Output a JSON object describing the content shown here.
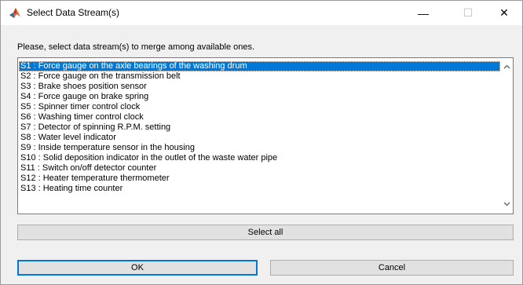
{
  "window": {
    "title": "Select Data Stream(s)",
    "controls": {
      "minimize": "—",
      "maximize": "☐",
      "close": "✕"
    }
  },
  "prompt": "Please, select data stream(s) to merge among available ones.",
  "streams": [
    {
      "label": "S1 : Force gauge on the axle bearings of the washing drum",
      "selected": true
    },
    {
      "label": "S2 : Force gauge on the transmission belt",
      "selected": false
    },
    {
      "label": "S3 : Brake shoes position sensor",
      "selected": false
    },
    {
      "label": "S4 : Force gauge on brake spring",
      "selected": false
    },
    {
      "label": "S5 : Spinner timer control clock",
      "selected": false
    },
    {
      "label": "S6 : Washing timer control clock",
      "selected": false
    },
    {
      "label": "S7 : Detector of spinning R.P.M. setting",
      "selected": false
    },
    {
      "label": "S8 : Water level indicator",
      "selected": false
    },
    {
      "label": "S9 : Inside temperature sensor in the housing",
      "selected": false
    },
    {
      "label": "S10 : Solid deposition indicator in the outlet of the waste water pipe",
      "selected": false
    },
    {
      "label": "S11 : Switch on/off detector counter",
      "selected": false
    },
    {
      "label": "S12 : Heater temperature thermometer",
      "selected": false
    },
    {
      "label": "S13 : Heating time counter",
      "selected": false
    }
  ],
  "buttons": {
    "select_all": "Select all",
    "ok": "OK",
    "cancel": "Cancel"
  },
  "colors": {
    "selection": "#0078d7",
    "dialog_bg": "#f0f0f0",
    "button_bg": "#e1e1e1"
  },
  "icons": {
    "app": "matlab-icon",
    "scroll_up": "chevron-up-icon",
    "scroll_down": "chevron-down-icon"
  }
}
